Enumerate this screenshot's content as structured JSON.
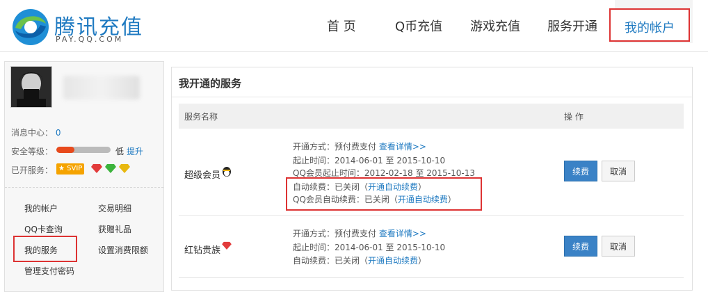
{
  "brand": {
    "title_cn": "腾讯充值",
    "title_en": "PAY.QQ.COM"
  },
  "nav": {
    "items": [
      "首 页",
      "Q币充值",
      "游戏充值",
      "服务开通"
    ],
    "active": "我的帐户"
  },
  "sidebar": {
    "info": {
      "msg_label": "消息中心：",
      "msg_count": "0",
      "security_label": "安全等级：",
      "security_level_text": "低",
      "security_upgrade": "提升",
      "security_fill": 0.33,
      "services_label": "已开服务：",
      "vip_badge": "SVIP"
    },
    "menu": [
      "我的帐户",
      "交易明细",
      "QQ卡查询",
      "获赠礼品",
      "我的服务",
      "设置消费限额",
      "管理支付密码"
    ]
  },
  "main": {
    "title": "我开通的服务",
    "headers": {
      "name": "服务名称",
      "action": "操 作"
    },
    "rows": [
      {
        "name": "超级会员",
        "lines": [
          {
            "text": "开通方式：预付费支付",
            "link": "查看详情>>"
          },
          {
            "text": "起止时间：2014-06-01 至 2015-10-10"
          },
          {
            "text": "QQ会员起止时间：2012-02-18 至 2015-10-13"
          },
          {
            "text": "自动续费：已关闭（",
            "link": "开通自动续费",
            "after": "）"
          },
          {
            "text": "QQ会员自动续费：已关闭（",
            "link": "开通自动续费",
            "after": "）"
          }
        ],
        "renew": "续费",
        "cancel": "取消"
      },
      {
        "name": "红钻贵族",
        "lines": [
          {
            "text": "开通方式：预付费支付",
            "link": "查看详情>>"
          },
          {
            "text": "起止时间：2014-06-01 至 2015-10-10"
          },
          {
            "text": "自动续费：已关闭（",
            "link": "开通自动续费",
            "after": "）"
          }
        ],
        "renew": "续费",
        "cancel": "取消"
      }
    ]
  },
  "colors": {
    "accent": "#1f7ac1",
    "highlight": "#dd3333",
    "button": "#3a82c6"
  }
}
